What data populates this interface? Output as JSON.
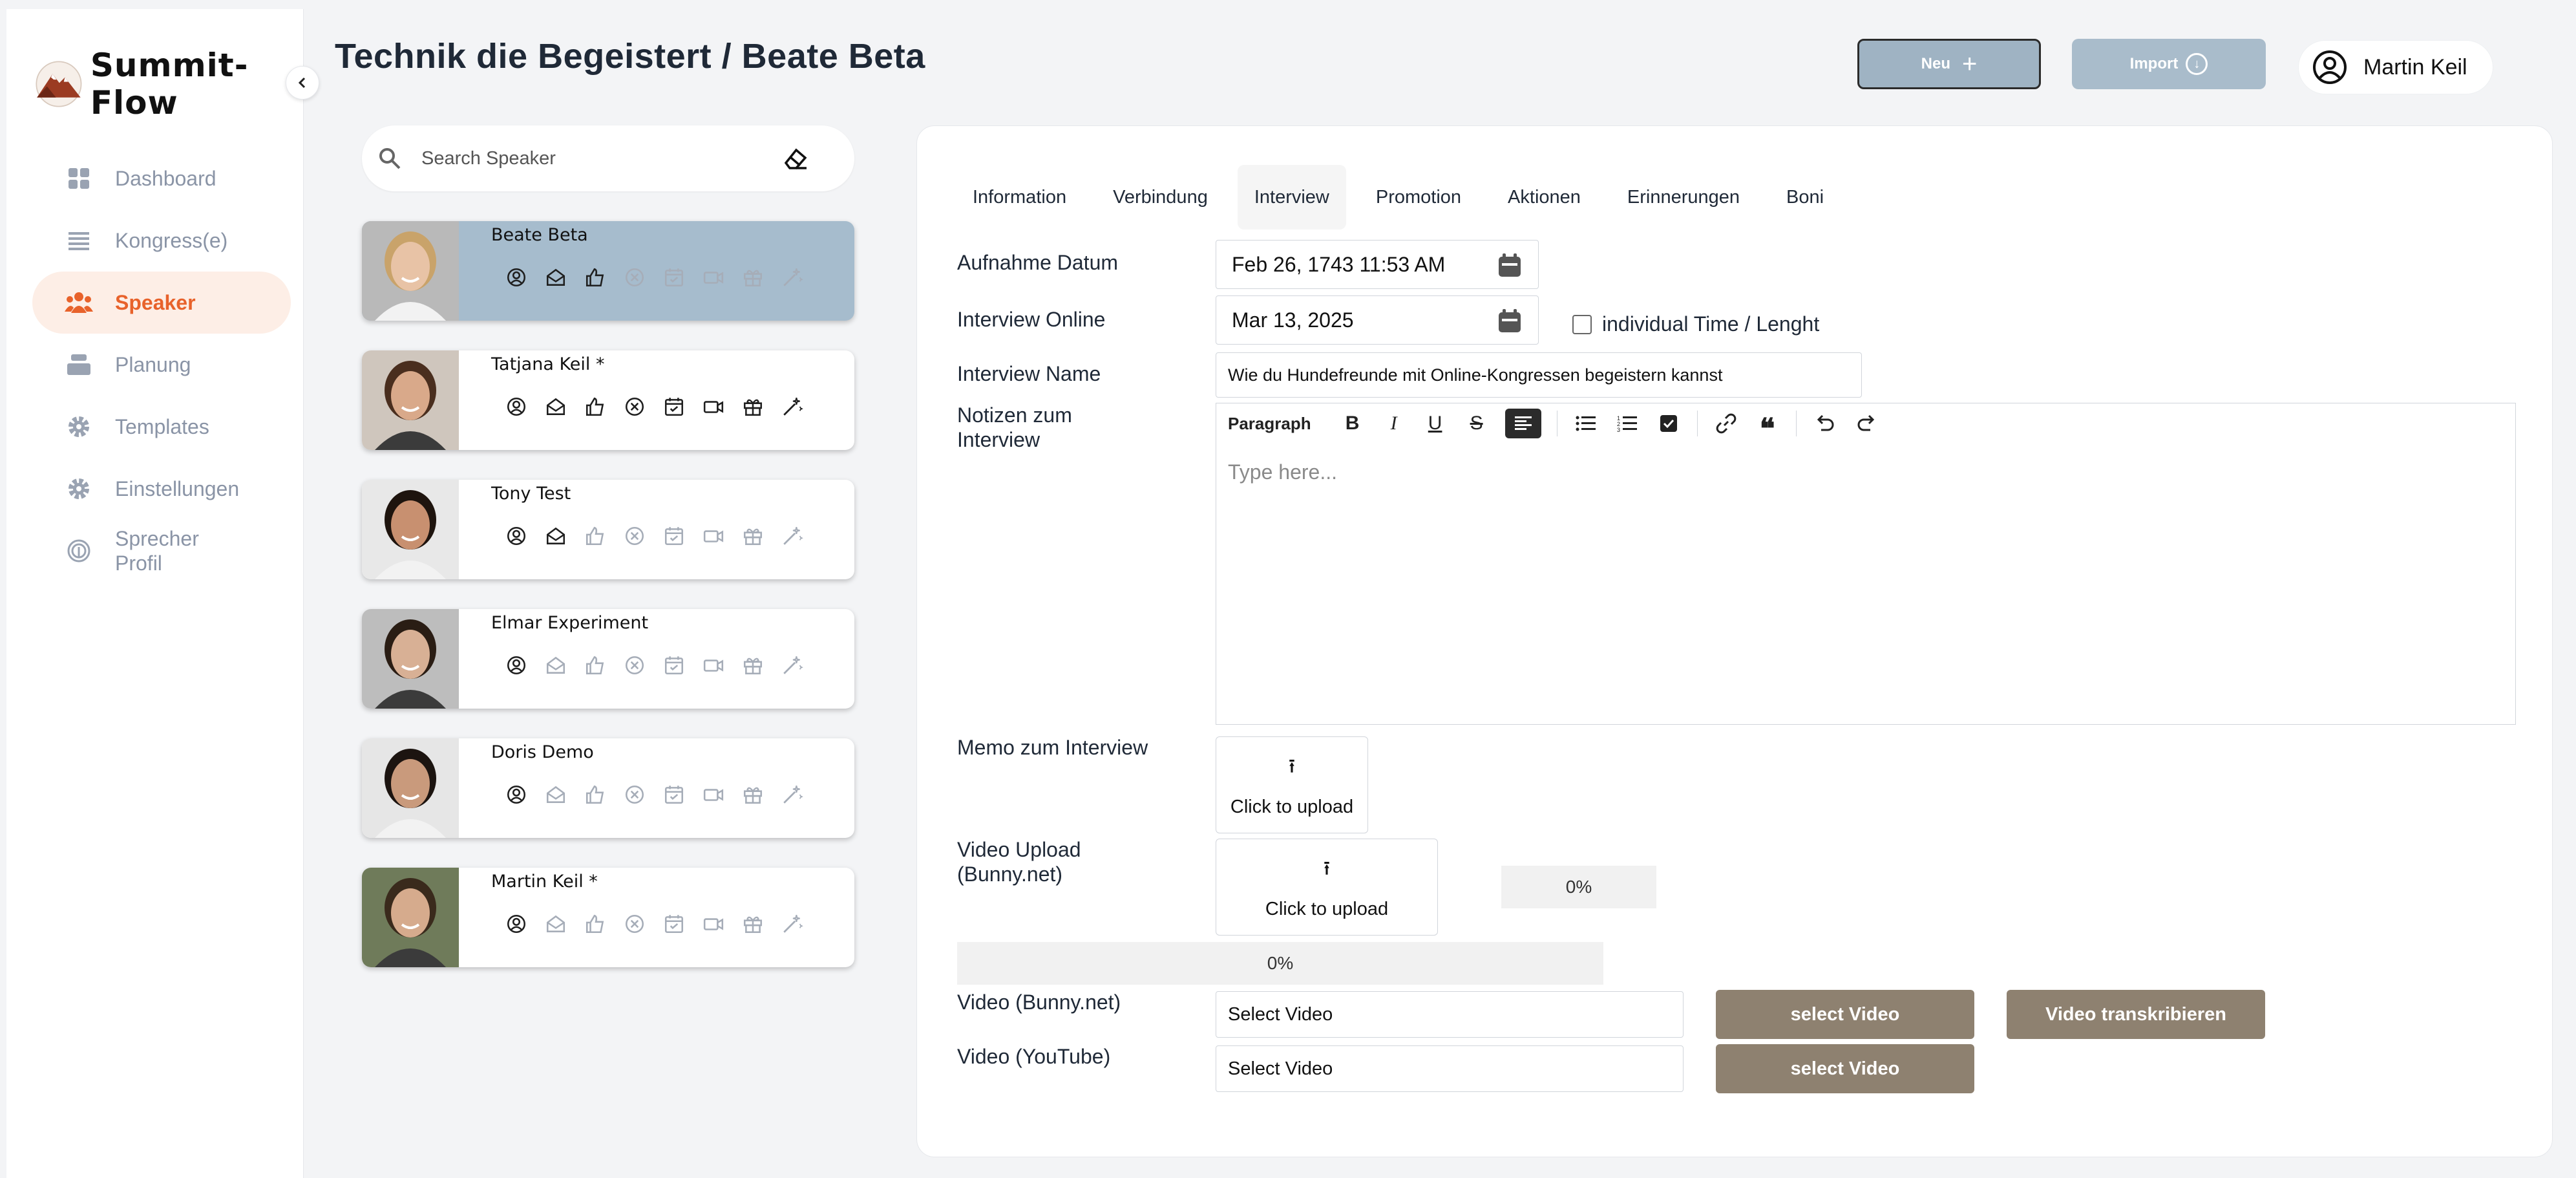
{
  "brand": {
    "name": "Summit-Flow"
  },
  "sidebar": {
    "items": [
      {
        "label": "Dashboard",
        "icon": "grid-icon"
      },
      {
        "label": "Kongress(e)",
        "icon": "list-icon"
      },
      {
        "label": "Speaker",
        "icon": "users-icon",
        "active": true
      },
      {
        "label": "Planung",
        "icon": "stack-icon"
      },
      {
        "label": "Templates",
        "icon": "gear-icon"
      },
      {
        "label": "Einstellungen",
        "icon": "gear-icon"
      },
      {
        "label": "Sprecher Profil",
        "icon": "fingerprint-icon"
      }
    ]
  },
  "header": {
    "title": "Technik die Begeistert / Beate Beta",
    "new_label": "Neu",
    "import_label": "Import",
    "user_name": "Martin Keil"
  },
  "search": {
    "placeholder": "Search Speaker"
  },
  "speakers": [
    {
      "name": "Beate Beta",
      "selected": true
    },
    {
      "name": "Tatjana Keil *"
    },
    {
      "name": "Tony Test"
    },
    {
      "name": "Elmar Experiment"
    },
    {
      "name": "Doris Demo"
    },
    {
      "name": "Martin Keil *"
    }
  ],
  "tabs": [
    "Information",
    "Verbindung",
    "Interview",
    "Promotion",
    "Aktionen",
    "Erinnerungen",
    "Boni"
  ],
  "active_tab": "Interview",
  "form": {
    "recording_date_label": "Aufnahme Datum",
    "recording_date_value": "Feb 26, 1743 11:53 AM",
    "online_label": "Interview Online",
    "online_value": "Mar 13, 2025",
    "individual_label": "individual Time / Lenght",
    "name_label": "Interview Name",
    "name_value": "Wie du Hundefreunde mit Online-Kongressen begeistern kannst",
    "notes_label": "Notizen zum Interview",
    "editor_paragraph": "Paragraph",
    "editor_placeholder": "Type here...",
    "memo_label": "Memo zum Interview",
    "upload_label": "Click to upload",
    "video_upload_label": "Video Upload (Bunny.net)",
    "video_upload_button": "Click to upload",
    "progress_small": "0%",
    "progress_large": "0%",
    "bunny_label": "Video (Bunny.net)",
    "bunny_select": "Select Video",
    "select_video_btn": "select Video",
    "transcribe_btn": "Video transkribieren",
    "youtube_label": "Video (YouTube)",
    "youtube_select": "Select Video",
    "select_video_btn2": "select Video"
  },
  "colors": {
    "accent": "#e8622b",
    "selected_card": "#a6bccd",
    "brown_button": "#8e8170"
  }
}
